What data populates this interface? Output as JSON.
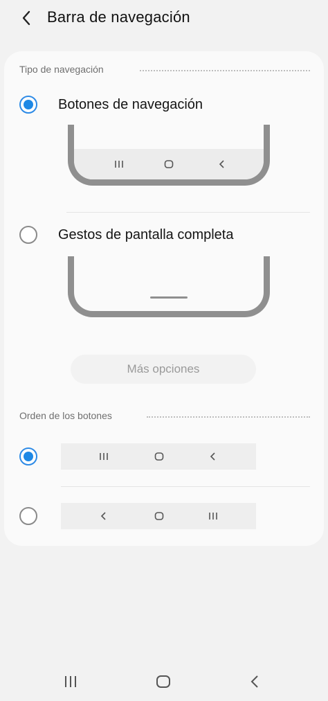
{
  "header": {
    "title": "Barra de navegación",
    "back_icon": "chevron-left-icon"
  },
  "navigation_type": {
    "section_label": "Tipo de navegación",
    "options": [
      {
        "label": "Botones de navegación",
        "selected": true
      },
      {
        "label": "Gestos de pantalla completa",
        "selected": false
      }
    ],
    "more_options_label": "Más opciones"
  },
  "button_order": {
    "section_label": "Orden de los botones",
    "options": [
      {
        "order": [
          "recents-icon",
          "home-icon",
          "back-icon"
        ],
        "selected": true
      },
      {
        "order": [
          "back-icon",
          "home-icon",
          "recents-icon"
        ],
        "selected": false
      }
    ]
  },
  "system_nav": [
    "recents-icon",
    "home-icon",
    "back-icon"
  ],
  "colors": {
    "accent": "#1e88e5",
    "background": "#f2f2f2",
    "card": "#fafafa",
    "illustration": "#8f8f8f"
  }
}
